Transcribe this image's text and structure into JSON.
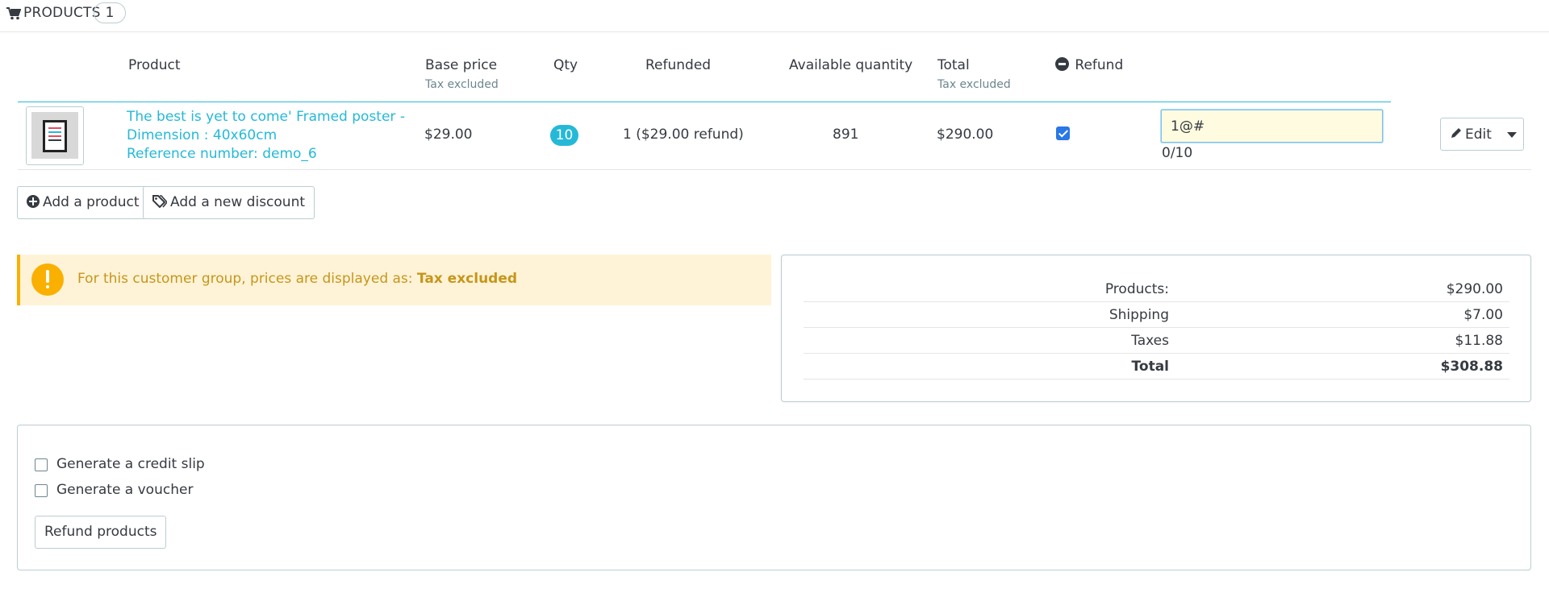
{
  "header": {
    "title": "PRODUCTS",
    "count": "1"
  },
  "table": {
    "columns": {
      "product": "Product",
      "base_price": "Base price",
      "base_price_sub": "Tax excluded",
      "qty": "Qty",
      "refunded": "Refunded",
      "available": "Available quantity",
      "total": "Total",
      "total_sub": "Tax excluded",
      "refund": "Refund"
    },
    "row": {
      "name_line1": "The best is yet to come' Framed poster -",
      "name_line2": "Dimension : 40x60cm",
      "reference": "Reference number: demo_6",
      "base_price": "$29.00",
      "qty": "10",
      "refunded": "1 ($29.00 refund)",
      "available": "891",
      "total": "$290.00",
      "refund_checked": true,
      "refund_qty_value": "1@#",
      "refund_counter": "0/10",
      "edit_label": "Edit"
    }
  },
  "actions": {
    "add_product": "Add a product",
    "add_discount": "Add a new discount"
  },
  "alert": {
    "message": "For this customer group, prices are displayed as: ",
    "emphasis": "Tax excluded"
  },
  "totals": [
    {
      "label": "Products:",
      "value": "$290.00"
    },
    {
      "label": "Shipping",
      "value": "$7.00"
    },
    {
      "label": "Taxes",
      "value": "$11.88"
    },
    {
      "label": "Total",
      "value": "$308.88"
    }
  ],
  "refund_options": {
    "credit_slip": "Generate a credit slip",
    "voucher": "Generate a voucher",
    "submit": "Refund products"
  },
  "colors": {
    "accent": "#25b9d7",
    "warning": "#fab000",
    "warning_bg": "#fff3d7",
    "text": "#363a41"
  }
}
